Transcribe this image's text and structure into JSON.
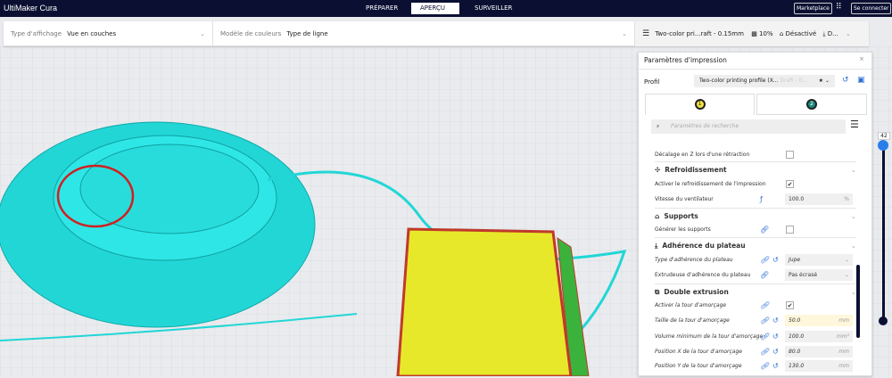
{
  "app": {
    "title": "UltiMaker Cura",
    "tabs": [
      "PRÉPARER",
      "APERÇU",
      "SURVEILLER"
    ],
    "active_tab": "APERÇU",
    "marketplace": "Marketplace",
    "signin": "Se connecter"
  },
  "toolbar": {
    "view_type_label": "Type d'affichage",
    "view_type_value": "Vue en couches",
    "color_scheme_label": "Modèle de couleurs",
    "color_scheme_value": "Type de ligne",
    "profile_summary": "Two-color pri...raft - 0.15mm",
    "infill": "10%",
    "support": "Désactivé",
    "adhesion": "D..."
  },
  "layer_slider": {
    "value": "42",
    "fraction": 0.79
  },
  "panel": {
    "title": "Paramètres d'impression",
    "profile_label": "Profil",
    "profile_value": "Two-color printing profile (X...",
    "profile_suffix": "Draft - 0...",
    "extruder_1": "1",
    "extruder_2": "2",
    "search_placeholder": "Paramètres de recherche",
    "rows": [
      {
        "label": "Décalage en Z lors d'une rétraction",
        "type": "checkbox",
        "checked": false
      },
      {
        "label": "Refroidissement",
        "type": "category",
        "icon": "fan-icon"
      },
      {
        "label": "Activer le refroidissement de l'impression",
        "type": "checkbox",
        "checked": true
      },
      {
        "label": "Vitesse du ventilateur",
        "type": "field",
        "value": "100.0",
        "unit": "%"
      },
      {
        "label": "Supports",
        "type": "category",
        "icon": "support-icon"
      },
      {
        "label": "Générer les supports",
        "type": "checkbox",
        "checked": false
      },
      {
        "label": "Adhérence du plateau",
        "type": "category",
        "icon": "adhesion-icon"
      },
      {
        "label": "Type d'adhérence du plateau",
        "type": "select",
        "value": "Jupe"
      },
      {
        "label": "Extrudeuse d'adhérence du plateau",
        "type": "select",
        "value": "Pas écrasé"
      },
      {
        "label": "Double extrusion",
        "type": "category",
        "icon": "dual-extrusion-icon"
      },
      {
        "label": "Activer la tour d'amorçage",
        "type": "checkbox",
        "checked": true
      },
      {
        "label": "Taille de la tour d'amorçage",
        "type": "field",
        "value": "50.0",
        "unit": "mm"
      },
      {
        "label": "Volume minimum de la tour d'amorçage",
        "type": "field",
        "value": "100.0",
        "unit": "mm³"
      },
      {
        "label": "Position X de la tour d'amorçage",
        "type": "field",
        "value": "80.0",
        "unit": "mm"
      },
      {
        "label": "Position Y de la tour d'amorçage",
        "type": "field",
        "value": "130.0",
        "unit": "mm"
      }
    ]
  }
}
